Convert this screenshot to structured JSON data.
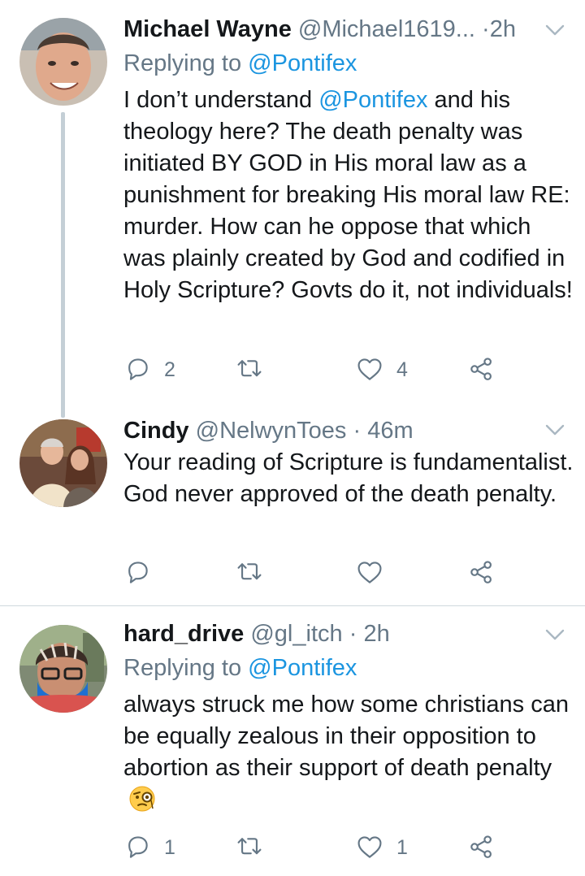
{
  "tweets": [
    {
      "display_name": "Michael Wayne",
      "handle": "@Michael1619...",
      "separator": "·",
      "time": "2h",
      "replying_prefix": "Replying to",
      "replying_to": "@Pontifex",
      "text_mention": "@Pontifex",
      "text_before": "I don’t understand ",
      "text_after": " and his theology here? The death penalty was initiated BY GOD in His moral law as a punishment for breaking His moral law RE: murder. How can he oppose that which was plainly created by God and codified in Holy Scripture? Govts do it, not individuals!",
      "reply_count": "2",
      "retweet_count": "",
      "like_count": "4"
    },
    {
      "display_name": "Cindy",
      "handle": "@NelwynToes",
      "separator": "·",
      "time": "46m",
      "text": "Your reading of Scripture is fundamentalist.  God never approved of the death penalty.",
      "reply_count": "",
      "retweet_count": "",
      "like_count": ""
    },
    {
      "display_name": "hard_drive",
      "handle": "@gl_itch",
      "separator": "·",
      "time": "2h",
      "replying_prefix": "Replying to",
      "replying_to": "@Pontifex",
      "text": "always struck me how some christians can be equally zealous in their opposition to abortion as their support of death penalty",
      "emoji": "face-with-monocle",
      "reply_count": "1",
      "retweet_count": "",
      "like_count": "1"
    }
  ],
  "icons": {
    "reply": "reply-icon",
    "retweet": "retweet-icon",
    "like": "heart-icon",
    "share": "share-icon",
    "caret": "chevron-down-icon"
  },
  "colors": {
    "text": "#14171a",
    "secondary": "#657786",
    "link": "#1b95e0",
    "thread_line": "#c4cfd6",
    "divider": "#cfd9de"
  }
}
